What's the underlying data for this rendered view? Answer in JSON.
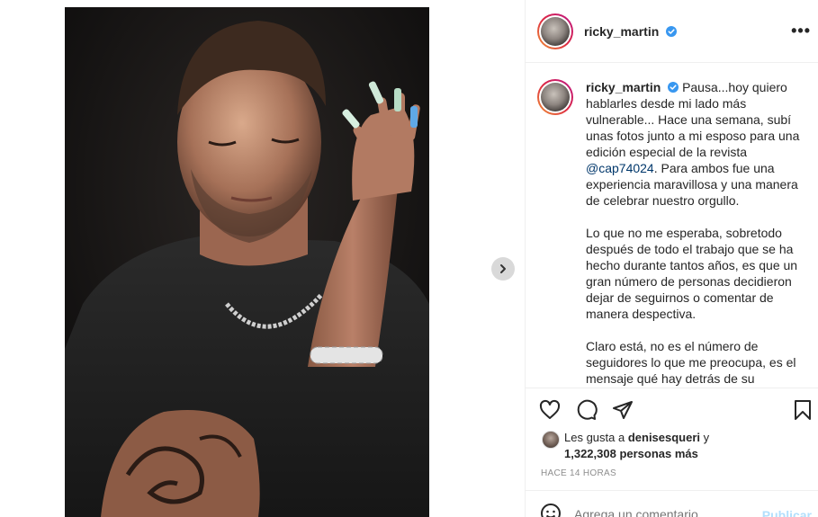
{
  "post": {
    "username": "ricky_martin",
    "verified": true,
    "more_icon": "more-dots-icon",
    "caption_username": "ricky_martin",
    "caption_p1_a": "Pausa...hoy quiero hablarles desde mi lado más vulnerable... Hace una semana, subí unas fotos junto a mi esposo para una edición especial de la revista ",
    "caption_mention": "@cap74024",
    "caption_p1_b": ". Para ambos fue una experiencia maravillosa y una manera de celebrar nuestro orgullo.",
    "caption_p2": "Lo que no me esperaba, sobretodo después de todo el trabajo que se ha hecho durante tantos años, es que un gran número de personas decidieron dejar de seguirnos o comentar de manera despectiva.",
    "caption_p3": "Claro está, no es el número de seguidores lo que me preocupa, es el mensaje qué hay detrás de su decisión"
  },
  "likes": {
    "prefix": "Les gusta a ",
    "first_user": "denisesqueri",
    "conjunction": " y",
    "count": "1,322,308 personas más"
  },
  "time_ago": "HACE 14 HORAS",
  "comment_box": {
    "placeholder": "Agrega un comentario...",
    "publish_label": "Publicar"
  },
  "colors": {
    "verified": "#3897f0",
    "mention": "#00376b",
    "publish_disabled": "#b2dffc",
    "muted": "#8e8e8e"
  }
}
